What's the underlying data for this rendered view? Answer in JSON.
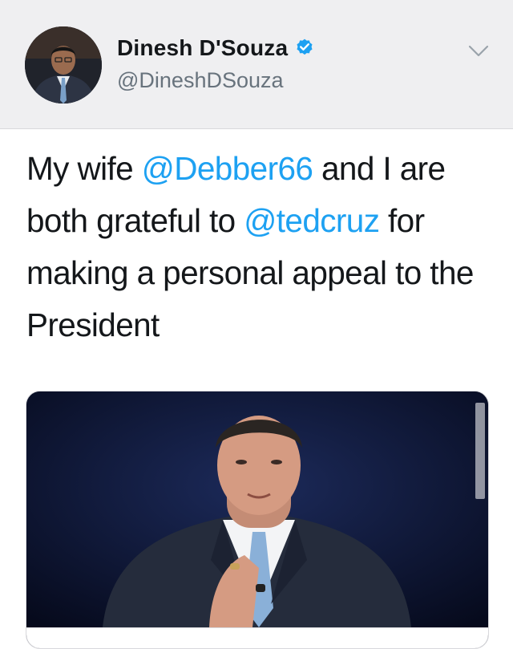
{
  "author": {
    "display_name": "Dinesh D'Souza",
    "handle": "@DineshDSouza",
    "verified": true
  },
  "tweet": {
    "text_parts": {
      "line1_a": "My wife ",
      "mention1": "@Debber66",
      "line1_b": " and I are both grateful to ",
      "mention2": "@tedcruz",
      "line1_c": " for making a personal appeal to the President"
    }
  },
  "icons": {
    "verified": "verified-badge-icon",
    "menu": "chevron-down-icon"
  },
  "colors": {
    "mention": "#1da1f2",
    "header_bg": "#efeff1",
    "text": "#14171a",
    "secondary_text": "#68737d"
  }
}
